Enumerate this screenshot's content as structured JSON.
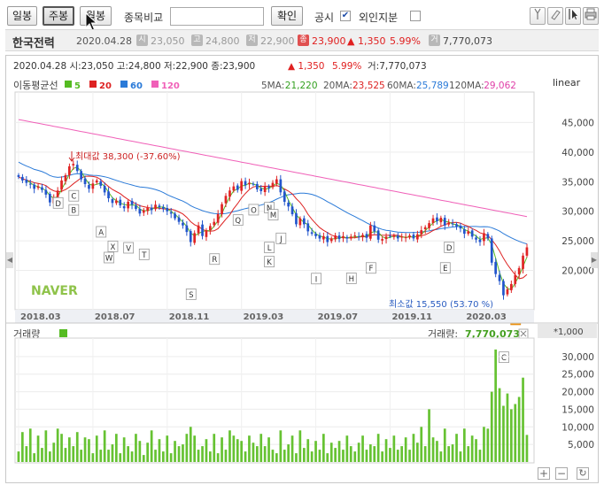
{
  "toolbar": {
    "period_buttons": [
      {
        "label": "일봉",
        "active": false
      },
      {
        "label": "주봉",
        "active": true
      },
      {
        "label": "월봉",
        "active": false
      }
    ],
    "compare_label": "종목비교",
    "compare_value": "",
    "confirm_label": "확인",
    "disclosure_label": "공시",
    "disclosure_checked": true,
    "foreign_label": "외인지분",
    "foreign_checked": false,
    "icon_buttons": [
      "crosshair-icon",
      "eraser-icon",
      "cursor-icon",
      "print-icon"
    ]
  },
  "stock": {
    "name": "한국전력",
    "date": "2020.04.28",
    "open_badge": "시",
    "open": "23,050",
    "high_badge": "고",
    "high": "24,800",
    "low_badge": "저",
    "low": "22,900",
    "close_badge": "종",
    "close": "23,900",
    "change": "▲ 1,350",
    "change_pct": "5.99%",
    "volume_badge": "거",
    "volume": "7,770,073"
  },
  "chart": {
    "header_line": "2020.04.28 시:23,050 고:24,800 저:22,900 종:23,900",
    "header_change": "▲   1,350",
    "header_pct": "5.99%",
    "header_volume": "거:7,770,073",
    "ma_title": "이동평균선",
    "ma_legend": [
      {
        "label": "5",
        "color": "#55bb22"
      },
      {
        "label": "20",
        "color": "#dd2222"
      },
      {
        "label": "60",
        "color": "#2a7ad8"
      },
      {
        "label": "120",
        "color": "#f060b8"
      }
    ],
    "ma_values": [
      {
        "label": "5MA:",
        "value": "21,220",
        "color": "#33a020"
      },
      {
        "label": "20MA:",
        "value": "23,525",
        "color": "#dd2222"
      },
      {
        "label": "60MA:",
        "value": "25,789",
        "color": "#2a7ad8"
      },
      {
        "label": "120MA:",
        "value": "29,062",
        "color": "#e040a8"
      }
    ],
    "scale_label": "linear",
    "watermark": "NAVER",
    "max_label": "최대값 38,300 (-37.60%)",
    "min_label": "최소값 15,550 (53.70 %)",
    "volume_title": "거래량",
    "volume_value_label": "거래량:",
    "volume_value": "7,770,073",
    "volume_unit": "*1,000",
    "zoom_in": "+",
    "zoom_out": "−",
    "reset": "↻"
  },
  "chart_data": {
    "type": "candlestick",
    "x_tick_labels": [
      "2018.03",
      "2018.07",
      "2018.11",
      "2019.03",
      "2019.07",
      "2019.11",
      "2020.03"
    ],
    "y_tick_labels": [
      "45,000",
      "40,000",
      "35,000",
      "30,000",
      "25,000",
      "20,000"
    ],
    "y_ticks": [
      45000,
      40000,
      35000,
      30000,
      25000,
      20000
    ],
    "ylim": [
      13500,
      50000
    ],
    "volume_tick_labels": [
      "30,000",
      "25,000",
      "20,000",
      "15,000",
      "10,000",
      "5,000"
    ],
    "volume_ticks": [
      30000,
      25000,
      20000,
      15000,
      10000,
      5000
    ],
    "volume_ylim": [
      0,
      35000
    ],
    "closes": [
      35800,
      35200,
      34800,
      34500,
      33800,
      34200,
      33600,
      32800,
      31500,
      32400,
      33500,
      35200,
      36100,
      37600,
      38000,
      36800,
      35400,
      34600,
      33800,
      34700,
      35200,
      34300,
      33200,
      32200,
      31400,
      31800,
      31000,
      30500,
      31600,
      31100,
      30400,
      29600,
      30200,
      30600,
      30200,
      31100,
      30700,
      30400,
      30000,
      29600,
      28800,
      28200,
      27600,
      26500,
      24800,
      26300,
      27600,
      25800,
      26800,
      27500,
      28200,
      29500,
      31200,
      32600,
      33500,
      34200,
      33600,
      35100,
      34400,
      34800,
      34600,
      33700,
      33400,
      34200,
      33900,
      34800,
      35400,
      33200,
      31600,
      30800,
      29500,
      27800,
      28800,
      27800,
      26600,
      26200,
      25800,
      25400,
      25800,
      24800,
      25400,
      25900,
      25300,
      25800,
      25400,
      25700,
      25900,
      25600,
      26000,
      25500,
      27600,
      26600,
      25200,
      25300,
      25700,
      25800,
      25900,
      25400,
      25700,
      25600,
      25900,
      25400,
      26100,
      26800,
      27300,
      28000,
      28800,
      28300,
      28900,
      27600,
      28100,
      27800,
      27400,
      27100,
      26200,
      26600,
      25700,
      25200,
      24800,
      26300,
      25400,
      21300,
      19400,
      18200,
      15800,
      16800,
      17700,
      19200,
      20400,
      22500,
      23900
    ],
    "volumes": [
      3000,
      8500,
      4500,
      9500,
      2500,
      7500,
      4000,
      9000,
      3000,
      5500,
      9500,
      8000,
      4000,
      7000,
      4500,
      8500,
      3500,
      7000,
      6500,
      2500,
      7500,
      3500,
      9000,
      3500,
      5000,
      8000,
      2500,
      7000,
      4500,
      3000,
      8000,
      6000,
      2000,
      5500,
      9000,
      3500,
      6500,
      3000,
      7500,
      2500,
      6000,
      4500,
      5000,
      8000,
      10000,
      7500,
      3500,
      4500,
      6500,
      3000,
      8000,
      2500,
      7000,
      3500,
      9000,
      7500,
      6500,
      6000,
      3000,
      7500,
      5500,
      4500,
      8000,
      4500,
      7000,
      3500,
      2500,
      9000,
      3500,
      5000,
      7500,
      2500,
      9000,
      4000,
      6500,
      3000,
      6000,
      3500,
      8000,
      2500,
      5500,
      4000,
      6000,
      3500,
      7500,
      4500,
      3000,
      5500,
      7500,
      3500,
      5000,
      4500,
      8000,
      3000,
      6500,
      4000,
      7500,
      3500,
      4500,
      7000,
      3500,
      8000,
      5500,
      10000,
      4500,
      15000,
      7000,
      6000,
      3000,
      9500,
      4500,
      5000,
      8000,
      3000,
      9500,
      4500,
      7500,
      6500,
      3500,
      10000,
      9500,
      20000,
      32000,
      21000,
      16000,
      19500,
      15000,
      16500,
      18500,
      24000,
      7700
    ],
    "annotations": [
      "D",
      "C",
      "B",
      "A",
      "X",
      "V",
      "W",
      "T",
      "S",
      "R",
      "Q",
      "O",
      "N",
      "M",
      "J",
      "L",
      "K",
      "I",
      "H",
      "F",
      "E",
      "D",
      "C",
      "A"
    ]
  }
}
